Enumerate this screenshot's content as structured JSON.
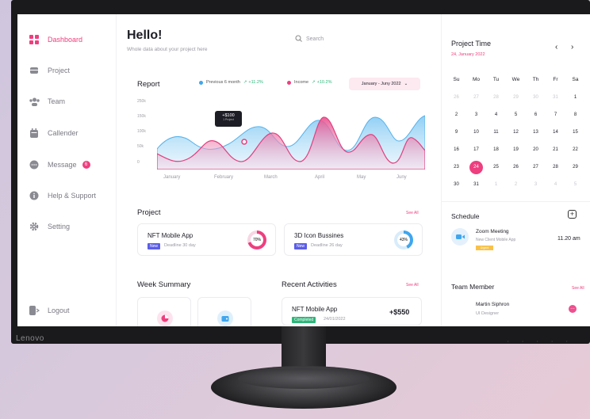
{
  "brand": "Lenovo",
  "sidebar": {
    "items": [
      {
        "label": "Dashboard"
      },
      {
        "label": "Project"
      },
      {
        "label": "Team"
      },
      {
        "label": "Callender"
      },
      {
        "label": "Message",
        "badge": "6"
      },
      {
        "label": "Help & Support"
      },
      {
        "label": "Setting"
      }
    ],
    "logout": "Logout"
  },
  "header": {
    "title": "Hello!",
    "subtitle": "Whole data about your project here",
    "search_placeholder": "Search"
  },
  "report": {
    "title": "Report",
    "legend_prev": "Previous 6 month",
    "legend_prev_pct": "+11.2%",
    "legend_income": "Income",
    "legend_income_pct": "+10.2%",
    "range": "January - Juny 2022",
    "tooltip_value": "+$100",
    "tooltip_sub": "1 Project"
  },
  "chart_data": {
    "type": "area",
    "categories": [
      "January",
      "February",
      "March",
      "April",
      "May",
      "Juny"
    ],
    "y_ticks": [
      "250k",
      "150k",
      "100k",
      "50k",
      "0"
    ],
    "series": [
      {
        "name": "Previous 6 month",
        "color": "#5fb8ef"
      },
      {
        "name": "Income",
        "color": "#e8508e"
      }
    ]
  },
  "project": {
    "title": "Project",
    "see_all": "See All",
    "cards": [
      {
        "title": "NFT Mobile App",
        "tag": "New",
        "deadline": "Deadline 30 day",
        "progress": "70%",
        "color": "#ee3f7e"
      },
      {
        "title": "3D Icon Bussines",
        "tag": "New",
        "deadline": "Deadline 26 day",
        "progress": "43%",
        "color": "#3fa6ee"
      }
    ]
  },
  "week": {
    "title": "Week Summary"
  },
  "recent": {
    "title": "Recent Activities",
    "see_all": "See All",
    "item_title": "NFT Mobile App",
    "item_status": "Completed",
    "item_date": "24/01/2022",
    "item_amount": "+$550"
  },
  "calendar": {
    "title": "Project Time",
    "date": "24, January 2022",
    "prev": "‹",
    "next": "›",
    "weekdays": [
      "Su",
      "Mo",
      "Tu",
      "We",
      "Th",
      "Fr",
      "Sa"
    ],
    "rows": [
      [
        "26",
        "27",
        "28",
        "29",
        "30",
        "31",
        "1"
      ],
      [
        "2",
        "3",
        "4",
        "5",
        "6",
        "7",
        "8"
      ],
      [
        "9",
        "10",
        "11",
        "12",
        "13",
        "14",
        "15"
      ],
      [
        "16",
        "17",
        "18",
        "19",
        "20",
        "21",
        "22"
      ],
      [
        "23",
        "24",
        "25",
        "26",
        "27",
        "28",
        "29"
      ],
      [
        "30",
        "31",
        "1",
        "2",
        "3",
        "4",
        "5"
      ]
    ]
  },
  "schedule": {
    "title": "Schedule",
    "add": "+",
    "event_title": "Zoom Meeting",
    "event_sub": "New Client Mobile App",
    "event_tag": "Urgent",
    "event_time": "11.20 am"
  },
  "team": {
    "title": "Team Member",
    "see_all": "See All",
    "name": "Martin Siphron",
    "role": "UI Designer"
  }
}
